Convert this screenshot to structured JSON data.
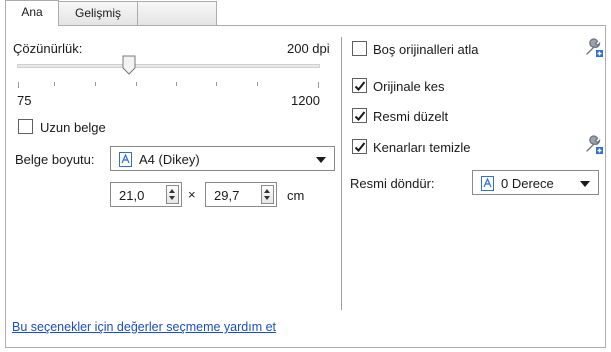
{
  "tabs": [
    {
      "label": "Ana"
    },
    {
      "label": "Gelişmiş"
    },
    {
      "label": ""
    }
  ],
  "resolution": {
    "label": "Çözünürlük:",
    "value_text": "200 dpi",
    "min_label": "75",
    "max_label": "1200",
    "value_fraction": 0.37
  },
  "long_document": {
    "label": "Uzun belge",
    "checked": false
  },
  "page_size": {
    "label": "Belge boyutu:",
    "selected": "A4 (Dikey)",
    "width": "21,0",
    "times": "×",
    "height": "29,7",
    "unit": "cm"
  },
  "options": {
    "skip_blank": {
      "label": "Boş orijinalleri atla",
      "checked": false
    },
    "crop_original": {
      "label": "Orijinale kes",
      "checked": true
    },
    "straighten": {
      "label": "Resmi düzelt",
      "checked": true
    },
    "edge_clean": {
      "label": "Kenarları temizle",
      "checked": true
    }
  },
  "rotate": {
    "label": "Resmi döndür:",
    "selected": "0 Derece"
  },
  "help_link": "Bu seçenekler için değerler seçmeme yardım et",
  "colors": {
    "link": "#1a4fc2",
    "accent_blue": "#2f6fd6"
  }
}
